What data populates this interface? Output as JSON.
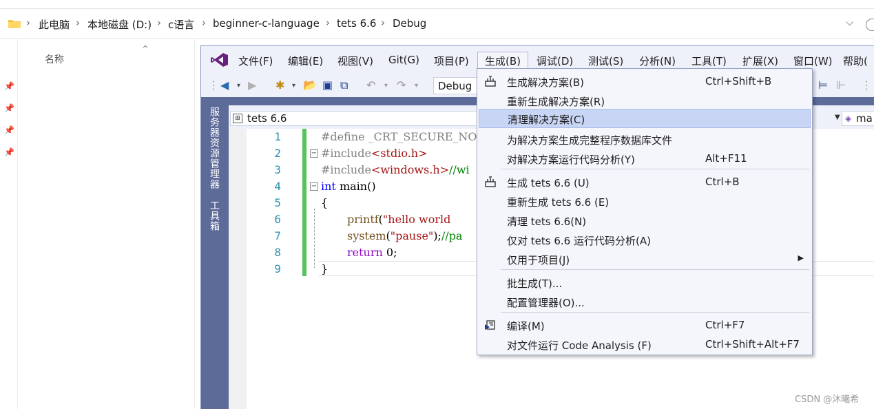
{
  "explorer": {
    "breadcrumbs": [
      "此电脑",
      "本地磁盘 (D:)",
      "c语言",
      "beginner-c-language",
      "tets 6.6",
      "Debug"
    ],
    "column_header": "名称"
  },
  "vs": {
    "menu": [
      "文件(F)",
      "编辑(E)",
      "视图(V)",
      "Git(G)",
      "项目(P)",
      "生成(B)",
      "调试(D)",
      "测试(S)",
      "分析(N)",
      "工具(T)",
      "扩展(X)",
      "窗口(W)",
      "帮助("
    ],
    "active_menu": "生成(B)",
    "configuration": "Debug",
    "side_tabs": [
      "服务器资源管理器",
      "工具箱"
    ],
    "project_combo": "tets 6.6",
    "member_combo": "ma",
    "line_numbers": [
      "1",
      "2",
      "3",
      "4",
      "5",
      "6",
      "7",
      "8",
      "9"
    ],
    "code": {
      "l1": "#define _CRT_SECURE_NO_W",
      "l2a": "#include",
      "l2b": "<stdio.h>",
      "l3a": "#include",
      "l3b": "<windows.h>",
      "l3c": "//wi",
      "l4a": "int",
      "l4b": " main()",
      "l5": "{",
      "l6a": "printf",
      "l6b": "(",
      "l6c": "\"hello world",
      "l7a": "system",
      "l7b": "(",
      "l7c": "\"pause\"",
      "l7d": ");",
      "l7e": "//pa",
      "l8a": "return",
      "l8b": " 0;",
      "l9": "}"
    }
  },
  "build_menu": {
    "items": [
      {
        "label": "生成解决方案(B)",
        "shortcut": "Ctrl+Shift+B",
        "icon": "build-solution-icon"
      },
      {
        "label": "重新生成解决方案(R)",
        "shortcut": ""
      },
      {
        "label": "清理解决方案(C)",
        "shortcut": "",
        "highlighted": true
      },
      {
        "label": "为解决方案生成完整程序数据库文件",
        "shortcut": ""
      },
      {
        "label": "对解决方案运行代码分析(Y)",
        "shortcut": "Alt+F11"
      },
      {
        "label": "生成 tets 6.6 (U)",
        "shortcut": "Ctrl+B",
        "icon": "build-project-icon"
      },
      {
        "label": "重新生成 tets 6.6 (E)",
        "shortcut": ""
      },
      {
        "label": "清理 tets 6.6(N)",
        "shortcut": ""
      },
      {
        "label": "仅对 tets 6.6 运行代码分析(A)",
        "shortcut": ""
      },
      {
        "label": "仅用于项目(J)",
        "shortcut": "",
        "submenu": true
      },
      {
        "label": "批生成(T)...",
        "shortcut": ""
      },
      {
        "label": "配置管理器(O)...",
        "shortcut": ""
      },
      {
        "label": "编译(M)",
        "shortcut": "Ctrl+F7",
        "icon": "compile-icon"
      },
      {
        "label": "对文件运行 Code Analysis (F)",
        "shortcut": "Ctrl+Shift+Alt+F7"
      }
    ]
  },
  "watermark": "CSDN @沐曦希",
  "colors": {
    "vs_purple": "#68217a",
    "side_band": "#5d6b99",
    "menu_bg": "#f5f6fc",
    "highlight": "#c9d5f5",
    "change_bar": "#57c35f"
  }
}
